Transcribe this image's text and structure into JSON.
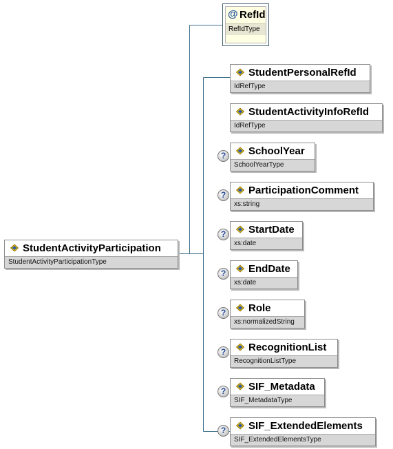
{
  "attribute": {
    "name": "RefId",
    "type": "RefIdType",
    "icon": "at-sign-icon"
  },
  "root": {
    "name": "StudentActivityParticipation",
    "type": "StudentActivityParticipationType"
  },
  "children": [
    {
      "name": "StudentPersonalRefId",
      "type": "IdRefType",
      "optional": false
    },
    {
      "name": "StudentActivityInfoRefId",
      "type": "IdRefType",
      "optional": false
    },
    {
      "name": "SchoolYear",
      "type": "SchoolYearType",
      "optional": true
    },
    {
      "name": "ParticipationComment",
      "type": "xs:string",
      "optional": true
    },
    {
      "name": "StartDate",
      "type": "xs:date",
      "optional": true
    },
    {
      "name": "EndDate",
      "type": "xs:date",
      "optional": true
    },
    {
      "name": "Role",
      "type": "xs:normalizedString",
      "optional": true
    },
    {
      "name": "RecognitionList",
      "type": "RecognitionListType",
      "optional": true
    },
    {
      "name": "SIF_Metadata",
      "type": "SIF_MetadataType",
      "optional": true
    },
    {
      "name": "SIF_ExtendedElements",
      "type": "SIF_ExtendedElementsType",
      "optional": true
    }
  ],
  "optional_marker": "?",
  "colors": {
    "connector": "#3b6e8a",
    "type_bar": "#d7d7d7",
    "attribute_fill": "#ffffe3",
    "marker": "#2b4f9a"
  }
}
